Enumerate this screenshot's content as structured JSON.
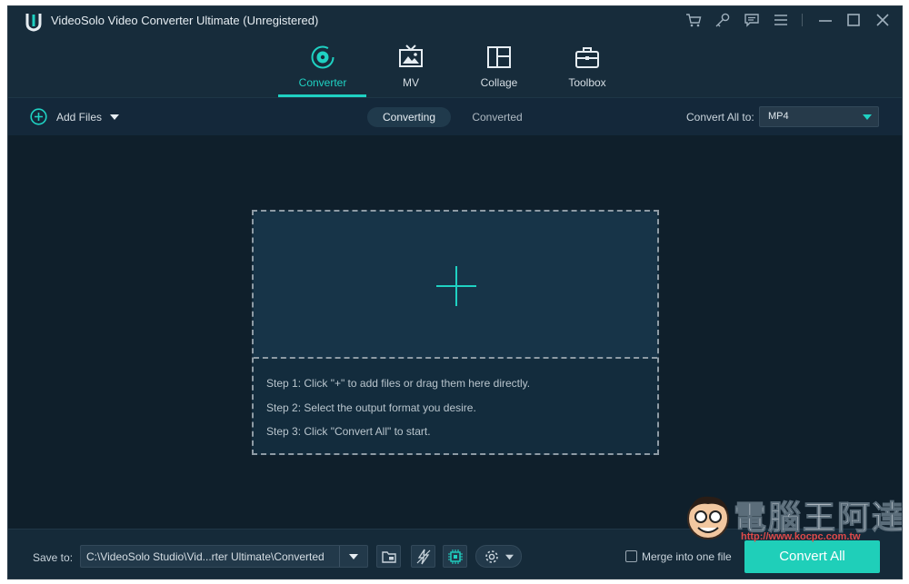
{
  "window": {
    "title": "VideoSolo Video Converter Ultimate (Unregistered)",
    "title_icons": [
      "cart-icon",
      "key-icon",
      "feedback-icon",
      "menu-icon",
      "minimize-icon",
      "maximize-icon",
      "close-icon"
    ]
  },
  "nav": {
    "tabs": [
      {
        "label": "Converter",
        "icon": "converter-disc-icon",
        "active": true
      },
      {
        "label": "MV",
        "icon": "mv-tv-icon",
        "active": false
      },
      {
        "label": "Collage",
        "icon": "collage-grid-icon",
        "active": false
      },
      {
        "label": "Toolbox",
        "icon": "toolbox-icon",
        "active": false
      }
    ]
  },
  "toolbar": {
    "add_files_label": "Add Files",
    "segments": [
      {
        "label": "Converting",
        "active": true
      },
      {
        "label": "Converted",
        "active": false
      }
    ],
    "convert_all_to_label": "Convert All to:",
    "format_value": "MP4"
  },
  "drop_zone": {
    "steps": [
      "Step 1: Click \"+\" to add files or drag them here directly.",
      "Step 2: Select the output format you desire.",
      "Step 3: Click \"Convert All\" to start."
    ]
  },
  "footer": {
    "save_to_label": "Save to:",
    "save_path": "C:\\VideoSolo Studio\\Vid...rter Ultimate\\Converted",
    "merge_label": "Merge into one file",
    "merge_checked": false,
    "convert_all_label": "Convert All"
  },
  "watermark": {
    "text": "電腦王阿達",
    "url": "http://www.kocpc.com.tw"
  },
  "colors": {
    "accent": "#1fd1c2",
    "background": "#0f1f2b",
    "header": "#172c3b",
    "convert_button": "#1fcfb9"
  }
}
